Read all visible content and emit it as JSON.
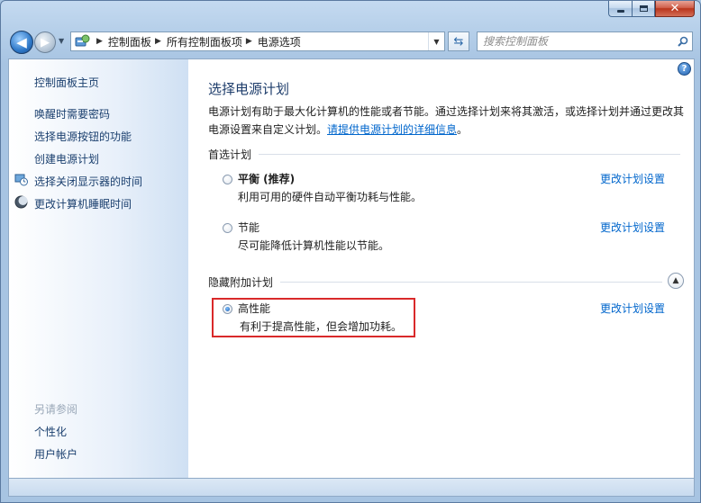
{
  "window": {
    "colors": {
      "accent": "#0066cc",
      "highlight": "#d9292a",
      "close": "#c0442c"
    }
  },
  "nav": {
    "breadcrumbs": [
      "控制面板",
      "所有控制面板项",
      "电源选项"
    ],
    "search_placeholder": "搜索控制面板"
  },
  "sidebar": {
    "home": "控制面板主页",
    "items": [
      {
        "label": "唤醒时需要密码",
        "icon": ""
      },
      {
        "label": "选择电源按钮的功能",
        "icon": ""
      },
      {
        "label": "创建电源计划",
        "icon": ""
      },
      {
        "label": "选择关闭显示器的时间",
        "icon": "monitor-clock-icon"
      },
      {
        "label": "更改计算机睡眠时间",
        "icon": "moon-icon"
      }
    ],
    "see_also_title": "另请参阅",
    "see_also": [
      "个性化",
      "用户帐户"
    ]
  },
  "main": {
    "title": "选择电源计划",
    "intro_text": "电源计划有助于最大化计算机的性能或者节能。通过选择计划来将其激活，或选择计划并通过更改其电源设置来自定义计划。",
    "intro_link": "请提供电源计划的详细信息",
    "intro_end": "。",
    "preferred_heading": "首选计划",
    "hidden_heading": "隐藏附加计划",
    "change_label": "更改计划设置",
    "plans": [
      {
        "name": "平衡 (推荐)",
        "desc": "利用可用的硬件自动平衡功耗与性能。",
        "selected": false
      },
      {
        "name": "节能",
        "desc": "尽可能降低计算机性能以节能。",
        "selected": false
      },
      {
        "name": "高性能",
        "desc": "有利于提高性能，但会增加功耗。",
        "selected": true
      }
    ]
  }
}
